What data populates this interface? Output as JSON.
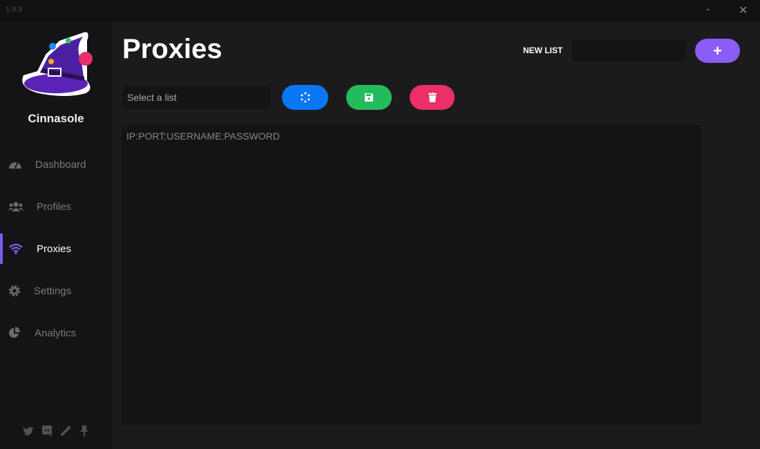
{
  "app": {
    "version": "1.9.9",
    "name": "Cinnasole"
  },
  "nav": [
    {
      "label": "Dashboard"
    },
    {
      "label": "Profiles"
    },
    {
      "label": "Proxies"
    },
    {
      "label": "Settings"
    },
    {
      "label": "Analytics"
    }
  ],
  "page": {
    "title": "Proxies",
    "new_list_label": "NEW LIST",
    "new_list_value": "",
    "add_label": "+",
    "select_placeholder": "Select a list",
    "textarea_placeholder": "IP:PORT:USERNAME:PASSWORD"
  },
  "colors": {
    "accent": "#8c5cf6",
    "refresh": "#0a78f5",
    "save": "#24bb5d",
    "delete": "#ec2f66"
  }
}
